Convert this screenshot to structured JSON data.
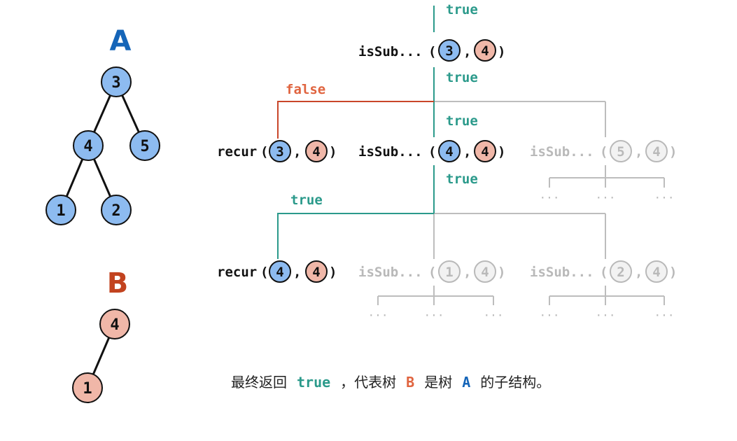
{
  "colors": {
    "blue_fill": "#8dbbf0",
    "red_fill": "#f0b7a8",
    "gray_fill": "#f2f2f2",
    "teal": "#2b9a8b",
    "orange": "#e0643f",
    "gray": "#b9b9b9",
    "blue_label": "#1565b8",
    "red_label": "#c2431f",
    "dark": "#111111"
  },
  "tree_a": {
    "label": "A",
    "nodes": [
      "3",
      "4",
      "5",
      "1",
      "2"
    ]
  },
  "tree_b": {
    "label": "B",
    "nodes": [
      "4",
      "1"
    ]
  },
  "calls": {
    "top": {
      "name": "isSub...",
      "args": [
        "3",
        "4"
      ]
    },
    "recur1": {
      "name": "recur",
      "args": [
        "3",
        "4"
      ]
    },
    "mid": {
      "name": "isSub...",
      "args": [
        "4",
        "4"
      ]
    },
    "right1": {
      "name": "isSub...",
      "args": [
        "5",
        "4"
      ]
    },
    "recur2": {
      "name": "recur",
      "args": [
        "4",
        "4"
      ]
    },
    "left2": {
      "name": "isSub...",
      "args": [
        "1",
        "4"
      ]
    },
    "right2": {
      "name": "isSub...",
      "args": [
        "2",
        "4"
      ]
    }
  },
  "edge_labels": {
    "top_true": "true",
    "below_top_true": "true",
    "false_label": "false",
    "mid_true": "true",
    "below_mid_true": "true",
    "recur2_true": "true"
  },
  "ellipsis": "···",
  "caption": {
    "part1": "最终返回",
    "kw_true": "true",
    "part2": "，代表树",
    "kw_b": "B",
    "part3": "是树",
    "kw_a": "A",
    "part4": "的子结构。"
  }
}
